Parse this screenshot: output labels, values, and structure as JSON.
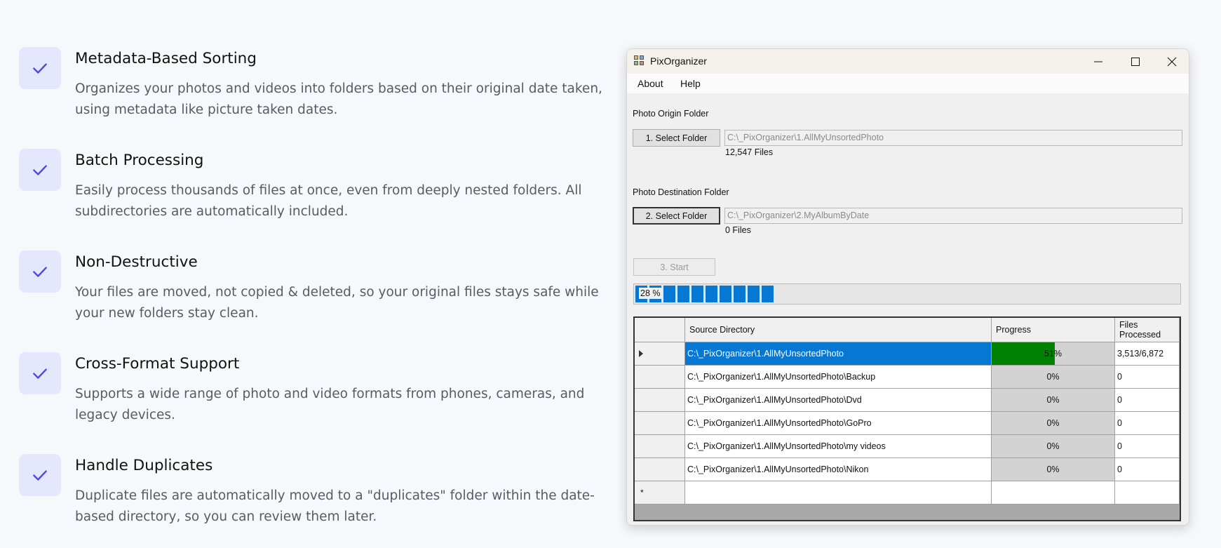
{
  "features": [
    {
      "title": "Metadata-Based Sorting",
      "desc_lines": [
        "Organizes your photos and videos into folders based on their original date taken,",
        "using metadata like picture taken dates."
      ]
    },
    {
      "title": "Batch Processing",
      "desc_lines": [
        "Easily process thousands of files at once, even from deeply nested folders. All",
        "subdirectories are automatically included."
      ]
    },
    {
      "title": "Non-Destructive",
      "desc_lines": [
        "Your files are moved, not copied & deleted, so your original files stays safe while",
        "your new folders stay clean."
      ]
    },
    {
      "title": "Cross-Format Support",
      "desc_lines": [
        "Supports a wide range of photo and video formats from phones, cameras, and",
        "legacy devices."
      ]
    },
    {
      "title": "Handle Duplicates",
      "desc_lines": [
        "Duplicate files are automatically moved to a \"duplicates\" folder within the date-",
        "based directory, so you can review them later."
      ]
    }
  ],
  "window": {
    "title": "PixOrganizer",
    "menu": [
      "About",
      "Help"
    ],
    "origin": {
      "label": "Photo Origin Folder",
      "button": "1. Select Folder",
      "path": "C:\\_PixOrganizer\\1.AllMyUnsortedPhoto",
      "count": "12,547 Files"
    },
    "destination": {
      "label": "Photo Destination Folder",
      "button": "2. Select Folder",
      "path": "C:\\_PixOrganizer\\2.MyAlbumByDate",
      "count": "0 Files"
    },
    "start_button": "3. Start",
    "progress": {
      "label": "28 %",
      "value": 0.28
    },
    "grid": {
      "columns": [
        "Source Directory",
        "Progress",
        "Files Processed"
      ],
      "rows": [
        {
          "source": "C:\\_PixOrganizer\\1.AllMyUnsortedPhoto",
          "progress_label": "51%",
          "progress": 0.51,
          "processed": "3,513/6,872",
          "selected": true
        },
        {
          "source": "C:\\_PixOrganizer\\1.AllMyUnsortedPhoto\\Backup",
          "progress_label": "0%",
          "progress": 0,
          "processed": "0",
          "selected": false
        },
        {
          "source": "C:\\_PixOrganizer\\1.AllMyUnsortedPhoto\\Dvd",
          "progress_label": "0%",
          "progress": 0,
          "processed": "0",
          "selected": false
        },
        {
          "source": "C:\\_PixOrganizer\\1.AllMyUnsortedPhoto\\GoPro",
          "progress_label": "0%",
          "progress": 0,
          "processed": "0",
          "selected": false
        },
        {
          "source": "C:\\_PixOrganizer\\1.AllMyUnsortedPhoto\\my videos",
          "progress_label": "0%",
          "progress": 0,
          "processed": "0",
          "selected": false
        },
        {
          "source": "C:\\_PixOrganizer\\1.AllMyUnsortedPhoto\\Nikon",
          "progress_label": "0%",
          "progress": 0,
          "processed": "0",
          "selected": false
        }
      ],
      "new_row_marker": "*"
    }
  },
  "colors": {
    "accent": "#0678d4",
    "check": "#4f46e5",
    "check_bg": "#e5e8fd",
    "progress_green": "#008000"
  }
}
